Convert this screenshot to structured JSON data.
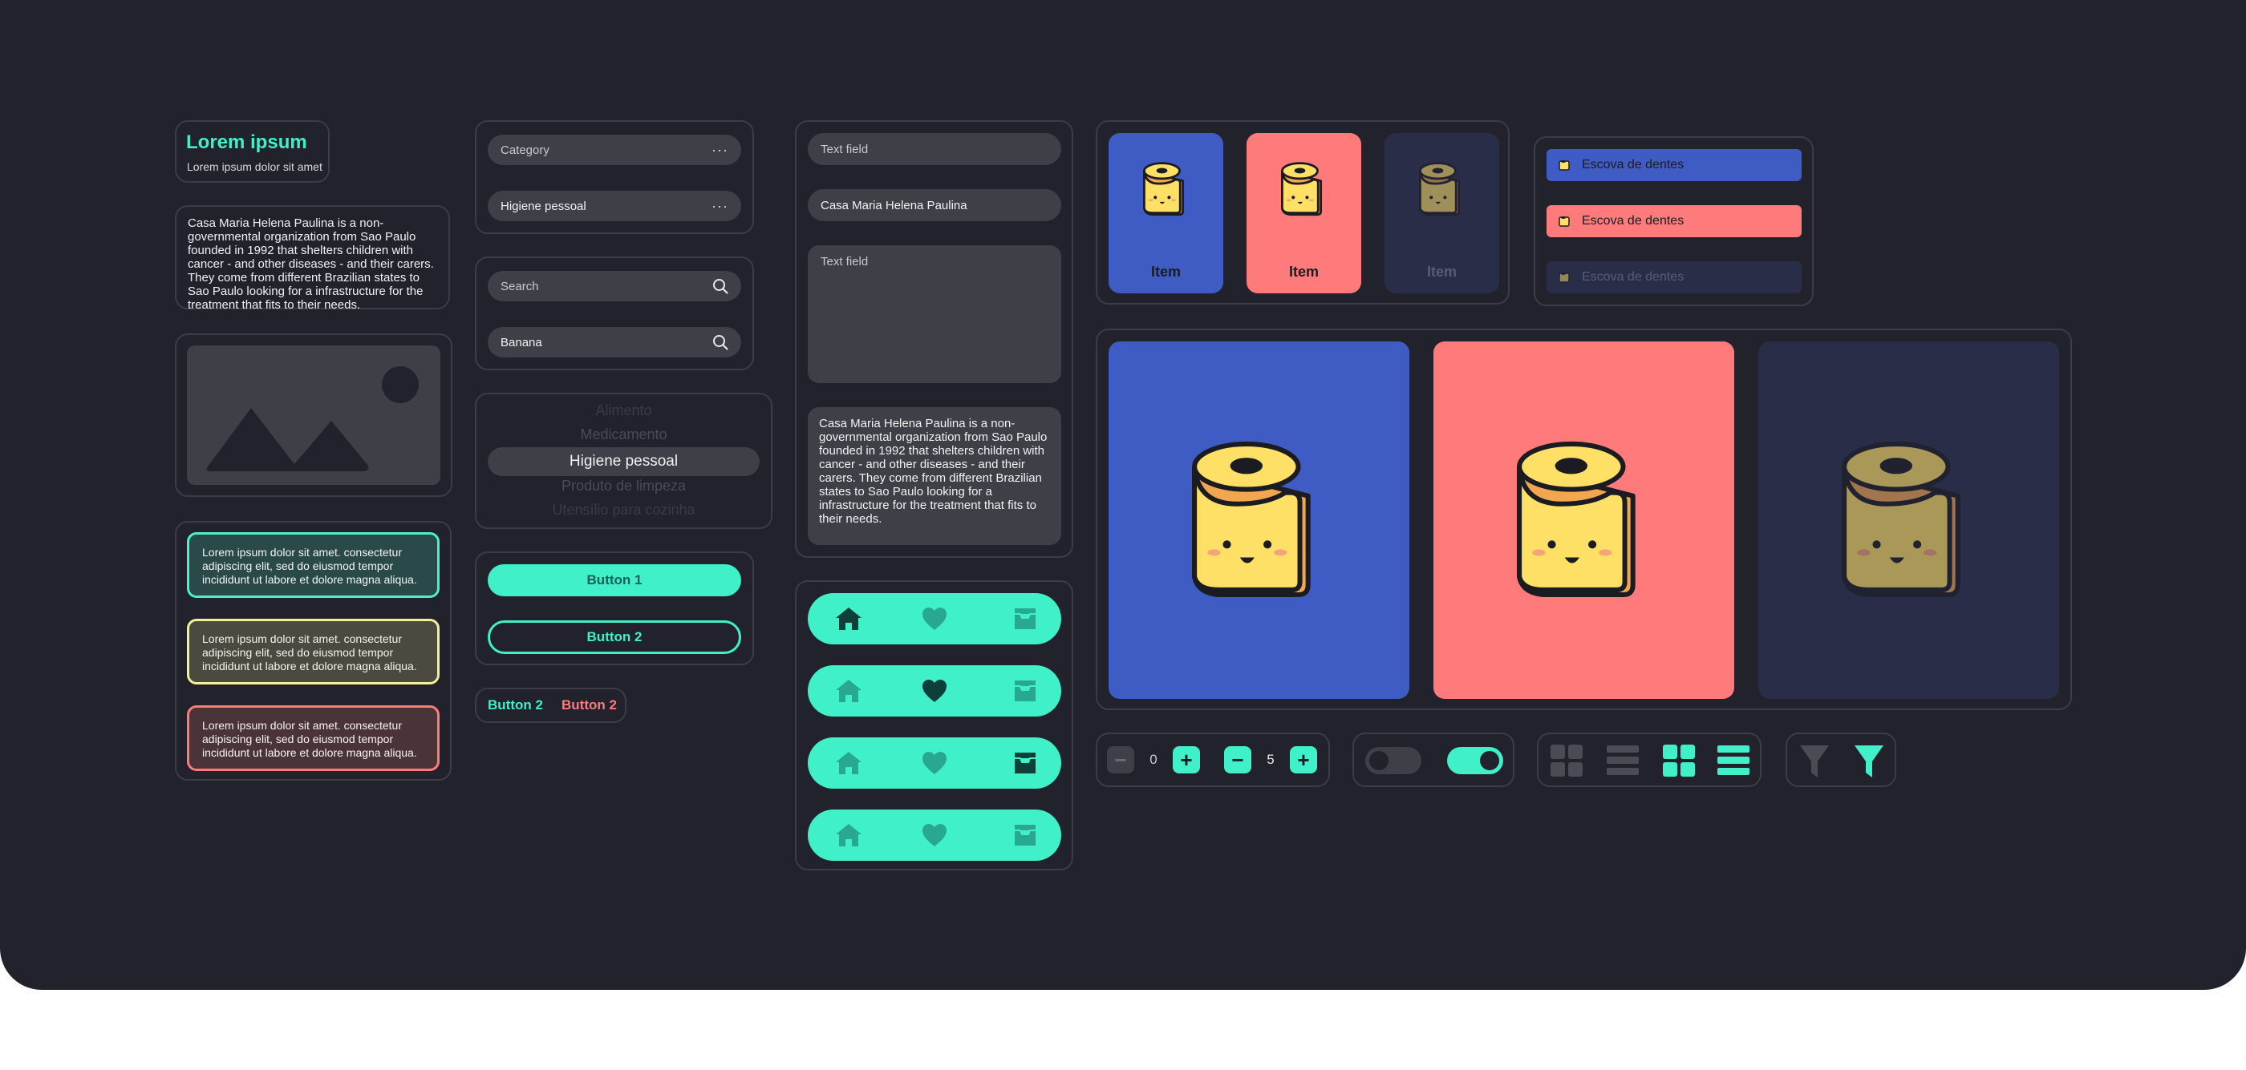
{
  "header": {
    "title": "Lorem ipsum",
    "subtitle": "Lorem ipsum dolor sit amet"
  },
  "description": "Casa Maria Helena Paulina is a non-governmental organization from Sao Paulo founded in 1992 that shelters children with cancer - and other diseases - and their carers. They come from different Brazilian states to Sao Paulo looking for a infrastructure for the treatment that fits to their needs.",
  "alerts": [
    {
      "text": "Lorem ipsum dolor sit amet. consectetur adipiscing elit, sed do eiusmod tempor incididunt ut labore et dolore magna aliqua.",
      "color": "#4ff0c8"
    },
    {
      "text": "Lorem ipsum dolor sit amet. consectetur adipiscing elit, sed do eiusmod tempor incididunt ut labore et dolore magna aliqua.",
      "color": "#f4ef9a"
    },
    {
      "text": "Lorem ipsum dolor sit amet. consectetur adipiscing elit, sed do eiusmod tempor incididunt ut labore et dolore magna aliqua.",
      "color": "#ff7b7b"
    }
  ],
  "dropdowns": {
    "category_placeholder": "Category",
    "category_value": "Higiene pessoal"
  },
  "search": {
    "placeholder": "Search",
    "value": "Banana"
  },
  "picker": {
    "items": [
      "Alimento",
      "Medicamento",
      "Higiene pessoal",
      "Produto de limpeza",
      "Utensílio para cozinha"
    ],
    "selected": "Higiene pessoal"
  },
  "buttons": {
    "primary": "Button 1",
    "outline": "Button 2",
    "text_teal": "Button 2",
    "text_red": "Button 2"
  },
  "textfields": {
    "placeholder": "Text field",
    "value": "Casa Maria Helena Paulina",
    "area_placeholder": "Text field"
  },
  "nav_variants": [
    "home",
    "favorites",
    "inbox",
    "home-inactive"
  ],
  "cards": [
    {
      "label": "Item",
      "bg": "#3f5cc4",
      "state": "active"
    },
    {
      "label": "Item",
      "bg": "#ff7b7b",
      "state": "active"
    },
    {
      "label": "Item",
      "bg": "#2a2d47",
      "state": "disabled"
    }
  ],
  "list_items": [
    {
      "label": "Escova de dentes",
      "bg": "#3f5cc4",
      "state": "active"
    },
    {
      "label": "Escova de dentes",
      "bg": "#ff7b7b",
      "state": "active"
    },
    {
      "label": "Escova de dentes",
      "bg": "#2a2d47",
      "state": "disabled"
    }
  ],
  "steppers": [
    {
      "value": "0",
      "state": "min"
    },
    {
      "value": "5",
      "state": "active"
    }
  ],
  "toggles": [
    {
      "state": "off"
    },
    {
      "state": "on"
    }
  ],
  "view_icons": [
    "grid-icon",
    "list-icon",
    "grid-icon-active",
    "list-icon-active"
  ],
  "filter_icons": [
    "filter-icon",
    "filter-icon-active"
  ],
  "colors": {
    "accent": "#3ff0c8",
    "background": "#21222b",
    "panel_border": "#3b3c45",
    "blue": "#3f5cc4",
    "red": "#ff7b7b",
    "navy": "#2a2d47"
  }
}
